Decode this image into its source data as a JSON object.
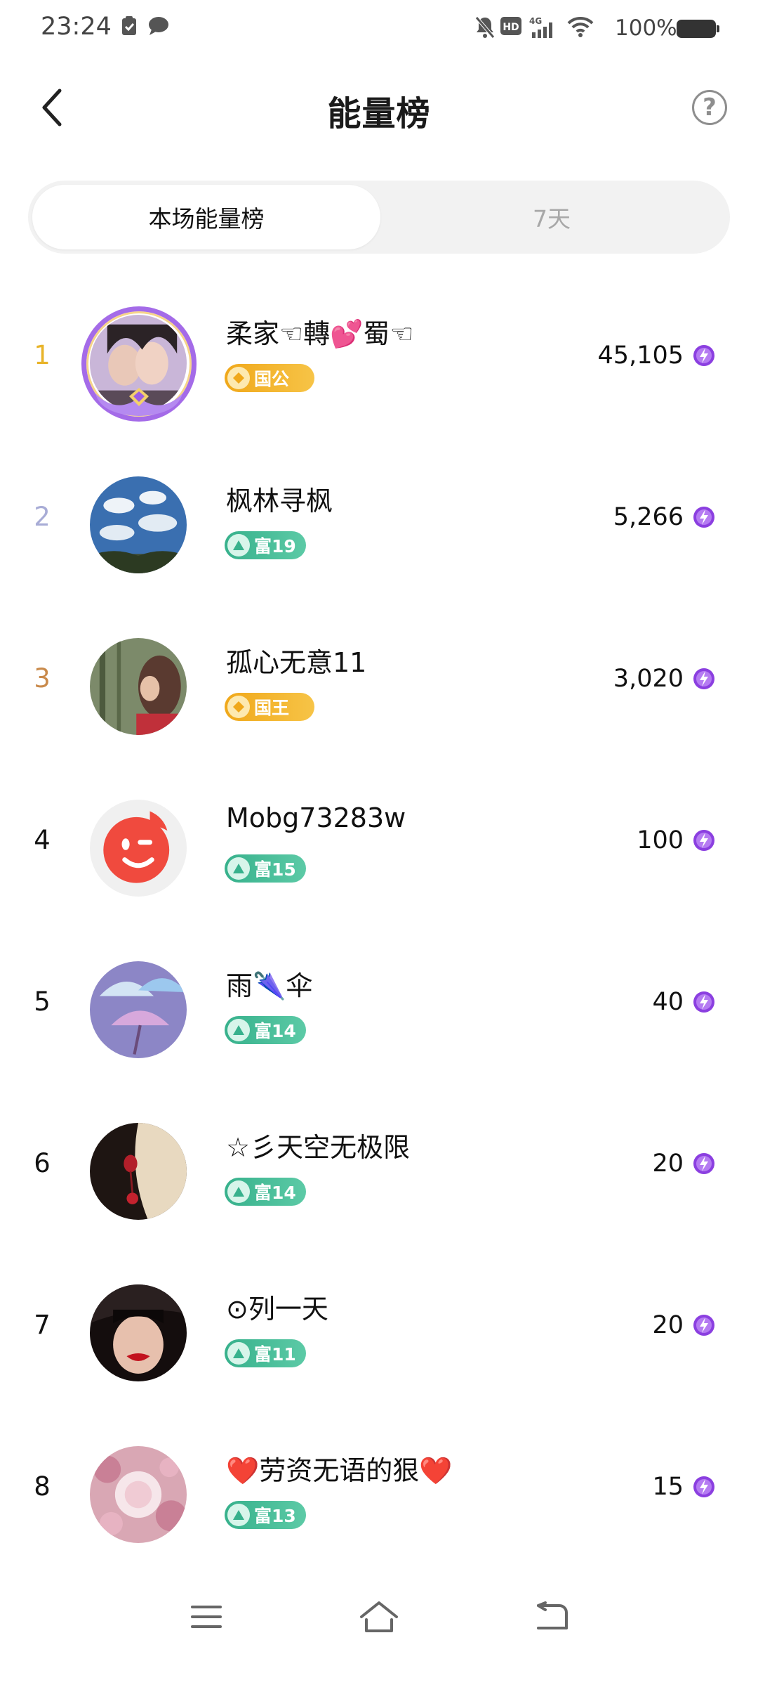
{
  "status_bar": {
    "time": "23:24",
    "battery": "100%",
    "network": "4G"
  },
  "header": {
    "title": "能量榜",
    "back_icon": "chevron-left-icon",
    "help_icon": "question-circle-icon"
  },
  "tabs": [
    {
      "label": "本场能量榜",
      "active": true
    },
    {
      "label": "7天",
      "active": false
    }
  ],
  "rank_colors": {
    "1": "#e8b429",
    "2": "#a8acd6",
    "3": "#c98a4b",
    "default": "#111111"
  },
  "ranking": [
    {
      "rank": "1",
      "name": "柔家☜轉💕蜀☜",
      "badge": "国公",
      "badge_type": "gold",
      "score": "45,105"
    },
    {
      "rank": "2",
      "name": "枫林寻枫",
      "badge": "富19",
      "badge_type": "green",
      "score": "5,266"
    },
    {
      "rank": "3",
      "name": "孤心无意11",
      "badge": "国王",
      "badge_type": "gold",
      "score": "3,020"
    },
    {
      "rank": "4",
      "name": "Mobg73283w",
      "badge": "富15",
      "badge_type": "green",
      "score": "100"
    },
    {
      "rank": "5",
      "name": "雨🌂伞",
      "badge": "富14",
      "badge_type": "green",
      "score": "40"
    },
    {
      "rank": "6",
      "name": "☆彡天空无极限",
      "badge": "富14",
      "badge_type": "green",
      "score": "20"
    },
    {
      "rank": "7",
      "name": "⊙列一天",
      "badge": "富11",
      "badge_type": "green",
      "score": "20"
    },
    {
      "rank": "8",
      "name": "❤️劳资无语的狠❤️",
      "badge": "富13",
      "badge_type": "green",
      "score": "15"
    }
  ],
  "nav_bar": {
    "menu_icon": "menu-icon",
    "home_icon": "home-icon",
    "back_icon": "back-icon"
  }
}
